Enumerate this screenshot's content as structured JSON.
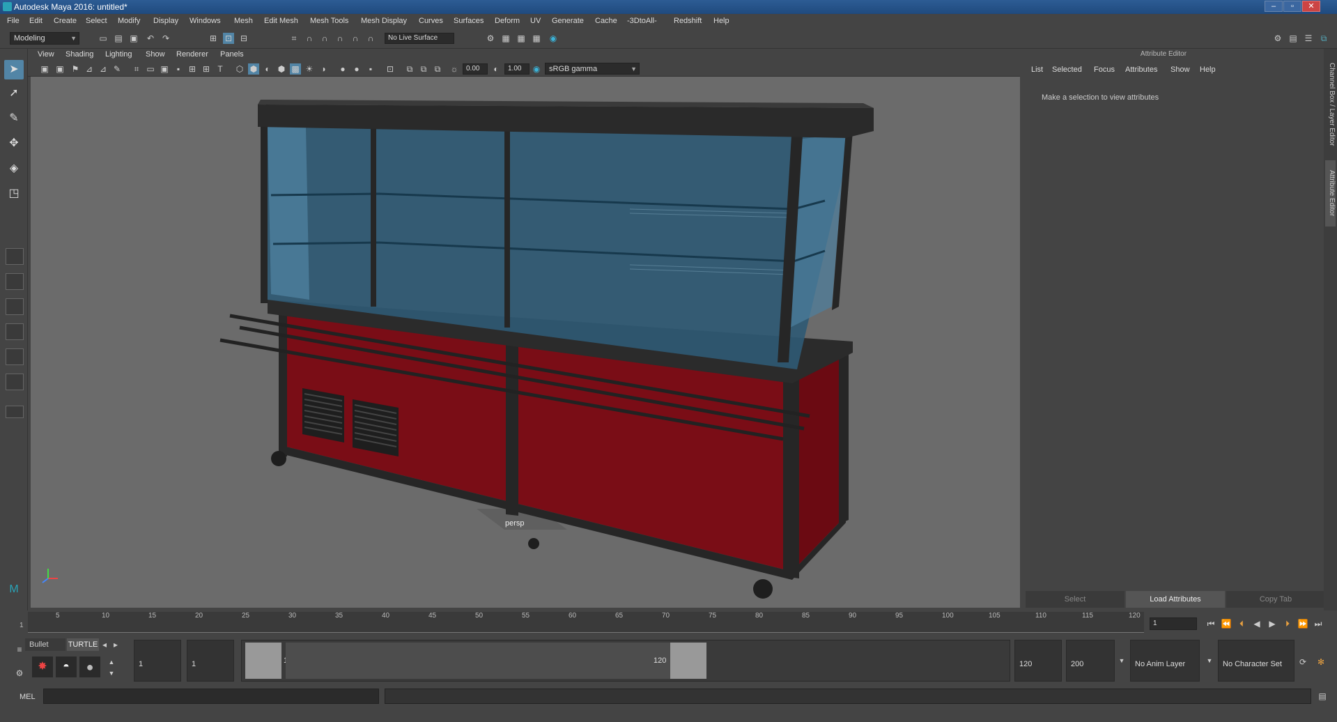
{
  "window": {
    "title": "Autodesk Maya 2016: untitled*"
  },
  "menus": [
    "File",
    "Edit",
    "Create",
    "Select",
    "Modify",
    "Display",
    "Windows",
    "Mesh",
    "Edit Mesh",
    "Mesh Tools",
    "Mesh Display",
    "Curves",
    "Surfaces",
    "Deform",
    "UV",
    "Generate",
    "Cache",
    "-3DtoAll-",
    "Redshift",
    "Help"
  ],
  "shelf": {
    "mode": "Modeling",
    "live_surface": "No Live Surface"
  },
  "viewport": {
    "menus": [
      "View",
      "Shading",
      "Lighting",
      "Show",
      "Renderer",
      "Panels"
    ],
    "exposure": "0.00",
    "gamma": "1.00",
    "color_space": "sRGB gamma",
    "camera_label": "persp"
  },
  "attribute_editor": {
    "title": "Attribute Editor",
    "menus": [
      "List",
      "Selected",
      "Focus",
      "Attributes",
      "Show",
      "Help"
    ],
    "message": "Make a selection to view attributes",
    "buttons": {
      "select": "Select",
      "load": "Load Attributes",
      "copy": "Copy Tab"
    },
    "side_tabs": [
      "Channel Box / Layer Editor",
      "Attribute Editor"
    ]
  },
  "timeline": {
    "ticks": [
      "5",
      "10",
      "15",
      "20",
      "25",
      "30",
      "35",
      "40",
      "45",
      "50",
      "55",
      "60",
      "65",
      "70",
      "75",
      "80",
      "85",
      "90",
      "95",
      "100",
      "105",
      "110",
      "115",
      "120"
    ],
    "start_marker": "1",
    "current_frame": "1"
  },
  "range": {
    "shelf_tabs": [
      "Bullet",
      "TURTLE"
    ],
    "start_time": "1",
    "playback_start": "1",
    "slider_start": "1",
    "slider_end": "120",
    "playback_end": "120",
    "end_time": "200",
    "anim_layer": "No Anim Layer",
    "character_set": "No Character Set"
  },
  "command_line": {
    "label": "MEL"
  },
  "colors": {
    "viewport_bg": "#6b6b6b",
    "cabinet_red": "#7a0d16",
    "glass": "#2f5a74",
    "frame": "#262626",
    "accent": "#5285a6"
  }
}
